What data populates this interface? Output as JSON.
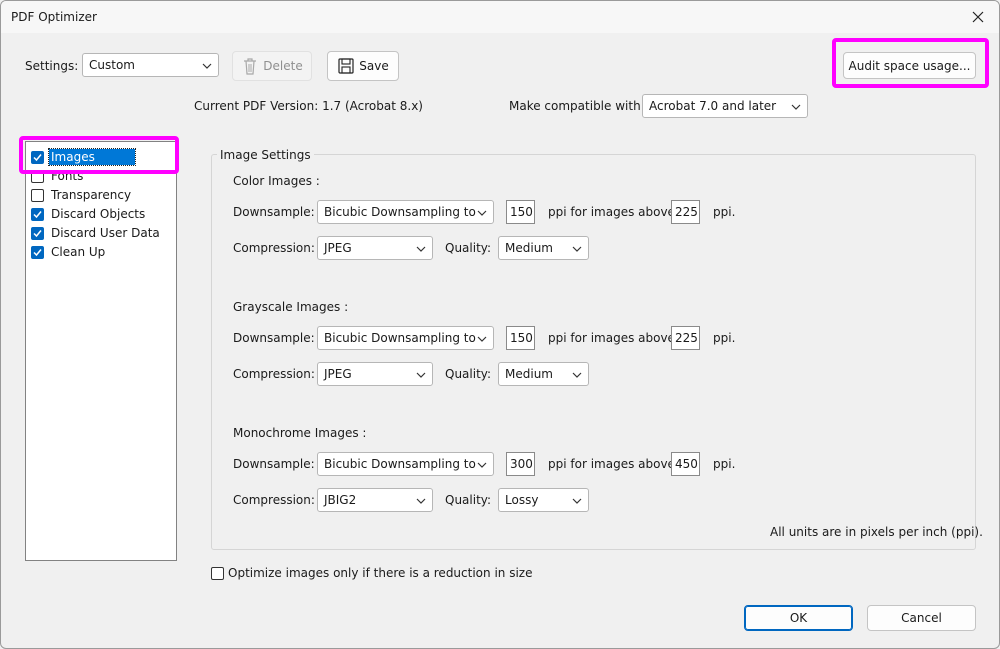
{
  "window": {
    "title": "PDF Optimizer"
  },
  "toolbar": {
    "settings_label": "Settings:",
    "settings_value": "Custom",
    "delete_label": "Delete",
    "save_label": "Save",
    "audit_label": "Audit space usage..."
  },
  "version": {
    "current_text": "Current PDF Version: 1.7 (Acrobat 8.x)",
    "compat_label": "Make compatible with:",
    "compat_value": "Acrobat 7.0 and later"
  },
  "sidebar": {
    "items": [
      {
        "label": "Images",
        "checked": true,
        "selected": true
      },
      {
        "label": "Fonts",
        "checked": false,
        "selected": false
      },
      {
        "label": "Transparency",
        "checked": false,
        "selected": false
      },
      {
        "label": "Discard Objects",
        "checked": true,
        "selected": false
      },
      {
        "label": "Discard User Data",
        "checked": true,
        "selected": false
      },
      {
        "label": "Clean Up",
        "checked": true,
        "selected": false
      }
    ]
  },
  "image_settings": {
    "title": "Image Settings",
    "downsample_label": "Downsample:",
    "compression_label": "Compression:",
    "quality_label": "Quality:",
    "ppi_above_label": "ppi for images above",
    "ppi_label": "ppi.",
    "color": {
      "heading": "Color Images :",
      "downsample": "Bicubic Downsampling to",
      "ppi_to": "150",
      "ppi_above": "225",
      "compression": "JPEG",
      "quality": "Medium"
    },
    "grayscale": {
      "heading": "Grayscale Images :",
      "downsample": "Bicubic Downsampling to",
      "ppi_to": "150",
      "ppi_above": "225",
      "compression": "JPEG",
      "quality": "Medium"
    },
    "mono": {
      "heading": "Monochrome Images :",
      "downsample": "Bicubic Downsampling to",
      "ppi_to": "300",
      "ppi_above": "450",
      "compression": "JBIG2",
      "quality": "Lossy"
    },
    "units_note": "All units are in pixels per inch (ppi)."
  },
  "optimize_only_label": "Optimize images only if there is a reduction in size",
  "footer": {
    "ok_label": "OK",
    "cancel_label": "Cancel"
  },
  "colors": {
    "accent": "#0067c0",
    "highlight": "#ff00ff",
    "selection": "#0078d7"
  }
}
